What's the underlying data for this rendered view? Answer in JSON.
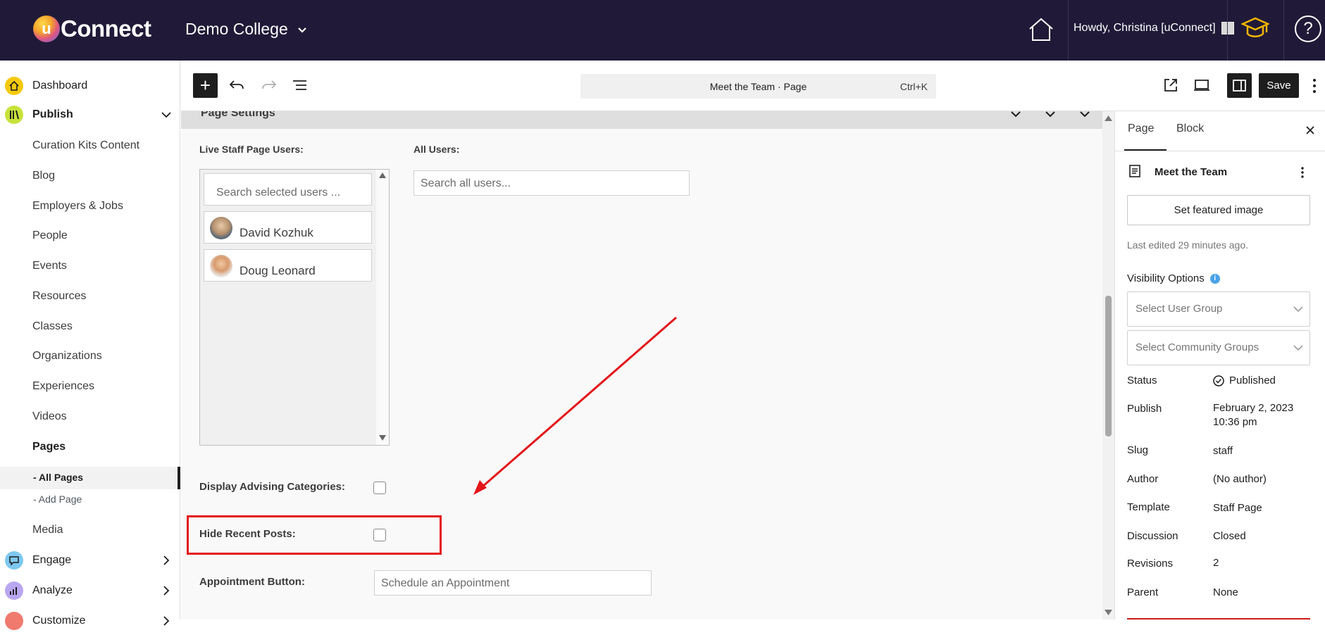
{
  "topbar": {
    "logo_letter": "u",
    "logo_text": "Connect",
    "college": "Demo College",
    "howdy": "Howdy, Christina [uConnect]"
  },
  "sidebar": {
    "dashboard": "Dashboard",
    "publish": "Publish",
    "items": [
      "Curation Kits Content",
      "Blog",
      "Employers & Jobs",
      "People",
      "Events",
      "Resources",
      "Classes",
      "Organizations",
      "Experiences",
      "Videos"
    ],
    "pages": "Pages",
    "all_pages": "All Pages",
    "add_page": "Add Page",
    "media": "Media",
    "engage": "Engage",
    "analyze": "Analyze",
    "customize": "Customize"
  },
  "toolbar": {
    "command_title": "Meet the Team · Page",
    "command_shortcut": "Ctrl+K",
    "save": "Save"
  },
  "editor": {
    "section_title": "Page Settings",
    "live_staff_label": "Live Staff Page Users:",
    "all_users_label": "All Users:",
    "search_selected_placeholder": "Search selected users ...",
    "search_all_placeholder": "Search all users...",
    "selected_users": [
      "David Kozhuk",
      "Doug Leonard"
    ],
    "display_advising_label": "Display Advising Categories:",
    "hide_recent_label": "Hide Recent Posts:",
    "appointment_label": "Appointment Button:",
    "appointment_placeholder": "Schedule an Appointment"
  },
  "panel": {
    "tab_page": "Page",
    "tab_block": "Block",
    "page_title": "Meet the Team",
    "featured_button": "Set featured image",
    "last_edited": "Last edited 29 minutes ago.",
    "visibility_label": "Visibility Options",
    "select_user_group": "Select User Group",
    "select_community": "Select Community Groups",
    "rows": [
      {
        "k": "Status",
        "v": "Published"
      },
      {
        "k": "Publish",
        "v": "February 2, 2023"
      },
      {
        "k": "Slug",
        "v": "staff"
      },
      {
        "k": "Author",
        "v": "(No author)"
      },
      {
        "k": "Template",
        "v": "Staff Page"
      },
      {
        "k": "Discussion",
        "v": "Closed"
      },
      {
        "k": "Revisions",
        "v": "2"
      },
      {
        "k": "Parent",
        "v": "None"
      }
    ],
    "publish_time": "10:36 pm"
  }
}
